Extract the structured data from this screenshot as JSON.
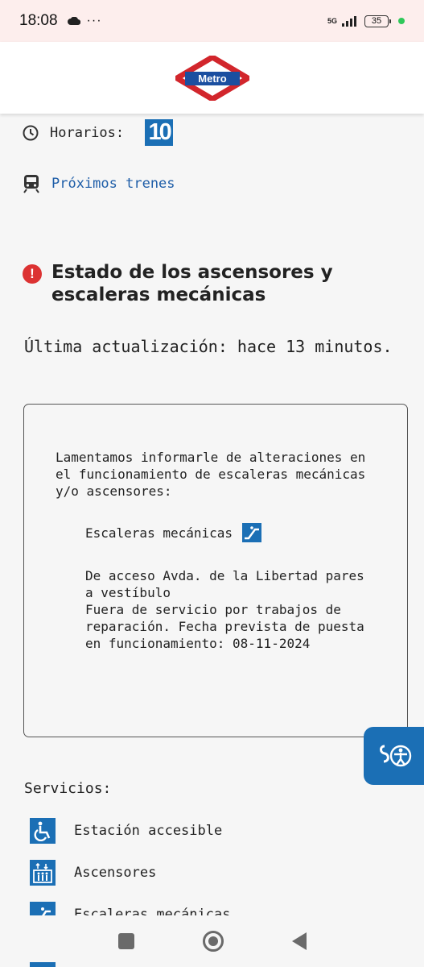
{
  "status_bar": {
    "time": "18:08",
    "dots": "···",
    "network": "5G",
    "battery": "35"
  },
  "header": {
    "logo_text": "Metro"
  },
  "horarios": {
    "label": "Horarios:",
    "line": "10"
  },
  "proximos": {
    "label": "Próximos trenes"
  },
  "estado": {
    "title": "Estado de los ascensores y escaleras mecánicas"
  },
  "update": {
    "text": "Última actualización: hace 13 minutos."
  },
  "notice": {
    "intro": "Lamentamos informarle de alteraciones en el funcionamiento de escaleras mecánicas y/o ascensores:",
    "category": "Escaleras mecánicas",
    "detail_line1": "De acceso Avda. de la Libertad pares a vestíbulo",
    "detail_line2": "Fuera de servicio por trabajos de reparación. Fecha prevista de puesta en funcionamiento: 08-11-2024"
  },
  "servicios": {
    "title": "Servicios:",
    "items": [
      {
        "label": "Estación accesible",
        "icon": "wheelchair-icon"
      },
      {
        "label": "Ascensores",
        "icon": "elevator-icon"
      },
      {
        "label": "Escaleras mecánicas",
        "icon": "escalator-icon"
      }
    ]
  },
  "colors": {
    "metro_blue": "#1b6fb5",
    "metro_red": "#d2262c",
    "alert_red": "#dc3232",
    "link_blue": "#1f5ea8"
  }
}
